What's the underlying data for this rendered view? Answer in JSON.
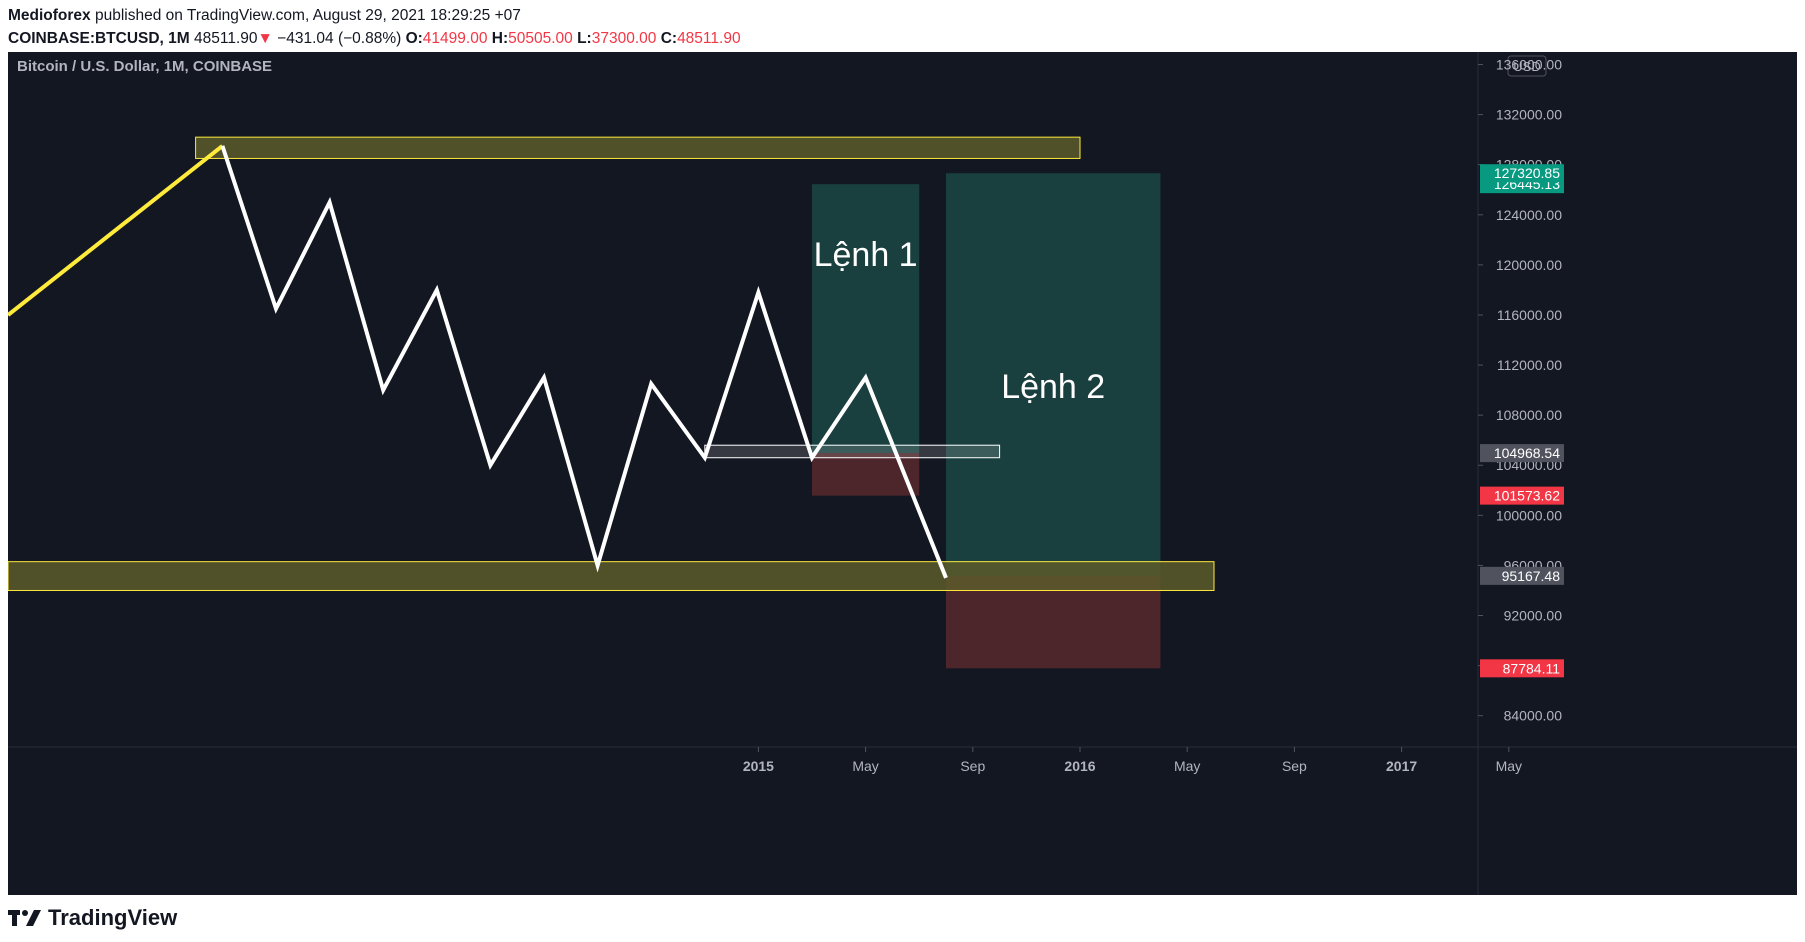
{
  "header": {
    "author": "Medioforex",
    "published_text": "published on TradingView.com, August 29, 2021 18:29:25 +07",
    "symbol": "COINBASE:BTCUSD, 1M",
    "last_price": "48511.90",
    "change_arrow": "▼",
    "change": "−431.04 (−0.88%)",
    "ohlc": [
      {
        "label": "O:",
        "value": "41499.00"
      },
      {
        "label": "H:",
        "value": "50505.00"
      },
      {
        "label": "L:",
        "value": "37300.00"
      },
      {
        "label": "C:",
        "value": "48511.90"
      }
    ]
  },
  "chart_title": "Bitcoin / U.S. Dollar, 1M, COINBASE",
  "currency": "USD",
  "footer": {
    "brand": "TradingView"
  },
  "colors": {
    "background": "#131722",
    "line": "#ffffff",
    "line_highlight": "#ffeb3b",
    "zone_fill": "#5c5a2a",
    "zone_border": "#ffeb3b",
    "profit": "#1e4d4a",
    "loss": "#5c2a2e",
    "axis_text": "#b2b5be",
    "price_green": "#089981",
    "price_red": "#f23645",
    "price_gray": "#50535e"
  },
  "chart_data": {
    "type": "line",
    "title": "Bitcoin / U.S. Dollar, 1M, COINBASE",
    "ylim": [
      81500,
      137000
    ],
    "y_ticks": [
      84000,
      88000,
      92000,
      96000,
      100000,
      104000,
      108000,
      112000,
      116000,
      120000,
      124000,
      128000,
      132000,
      136000
    ],
    "y_tick_labels": [
      "84000.00",
      "88000.00",
      "92000.00",
      "96000.00",
      "100000.00",
      "104000.00",
      "108000.00",
      "112000.00",
      "116000.00",
      "120000.00",
      "124000.00",
      "128000.00",
      "132000.00",
      "136000.00"
    ],
    "x_tick_labels": [
      "2015",
      "May",
      "Sep",
      "2016",
      "May",
      "Sep",
      "2017",
      "May"
    ],
    "x_ticks": [
      "2015-01",
      "2015-05",
      "2015-09",
      "2016-01",
      "2016-05",
      "2016-09",
      "2017-01",
      "2017-05"
    ],
    "grid": false,
    "series": [
      {
        "color": "#ffeb3b",
        "points": [
          {
            "x": "2012-09",
            "y": 116000
          },
          {
            "x": "2013-05",
            "y": 129500
          }
        ]
      },
      {
        "color": "#ffffff",
        "points": [
          {
            "x": "2013-05",
            "y": 129500
          },
          {
            "x": "2013-07",
            "y": 116500
          },
          {
            "x": "2013-09",
            "y": 125000
          },
          {
            "x": "2013-11",
            "y": 110000
          },
          {
            "x": "2014-01",
            "y": 118000
          },
          {
            "x": "2014-03",
            "y": 104000
          },
          {
            "x": "2014-05",
            "y": 111000
          },
          {
            "x": "2014-07",
            "y": 96000
          },
          {
            "x": "2014-09",
            "y": 110500
          },
          {
            "x": "2014-11",
            "y": 104600
          },
          {
            "x": "2015-01",
            "y": 117800
          },
          {
            "x": "2015-03",
            "y": 104600
          },
          {
            "x": "2015-05",
            "y": 111000
          },
          {
            "x": "2015-08",
            "y": 95000
          }
        ]
      }
    ],
    "zones": [
      {
        "kind": "resistance",
        "x0": "2013-04",
        "x1": "2016-01",
        "y0": 128500,
        "y1": 130200
      },
      {
        "kind": "support",
        "x0": "2012-09",
        "x1": "2016-06",
        "y0": 94000,
        "y1": 96300
      },
      {
        "kind": "level",
        "x0": "2014-11",
        "x1": "2015-10",
        "y0": 104600,
        "y1": 105600
      }
    ],
    "positions": [
      {
        "label": "Lệnh 1",
        "x0": "2015-03",
        "x1": "2015-07",
        "entry": 104968.54,
        "target": 126445.13,
        "stop": 101573.62,
        "entry_label": "104968.54",
        "target_label": "126445.13",
        "stop_label": "101573.62"
      },
      {
        "label": "Lệnh 2",
        "x0": "2015-08",
        "x1": "2016-04",
        "entry": 95167.48,
        "target": 127320.85,
        "stop": 87784.11,
        "entry_label": "95167.48",
        "target_label": "127320.85",
        "stop_label": "87784.11"
      }
    ]
  }
}
